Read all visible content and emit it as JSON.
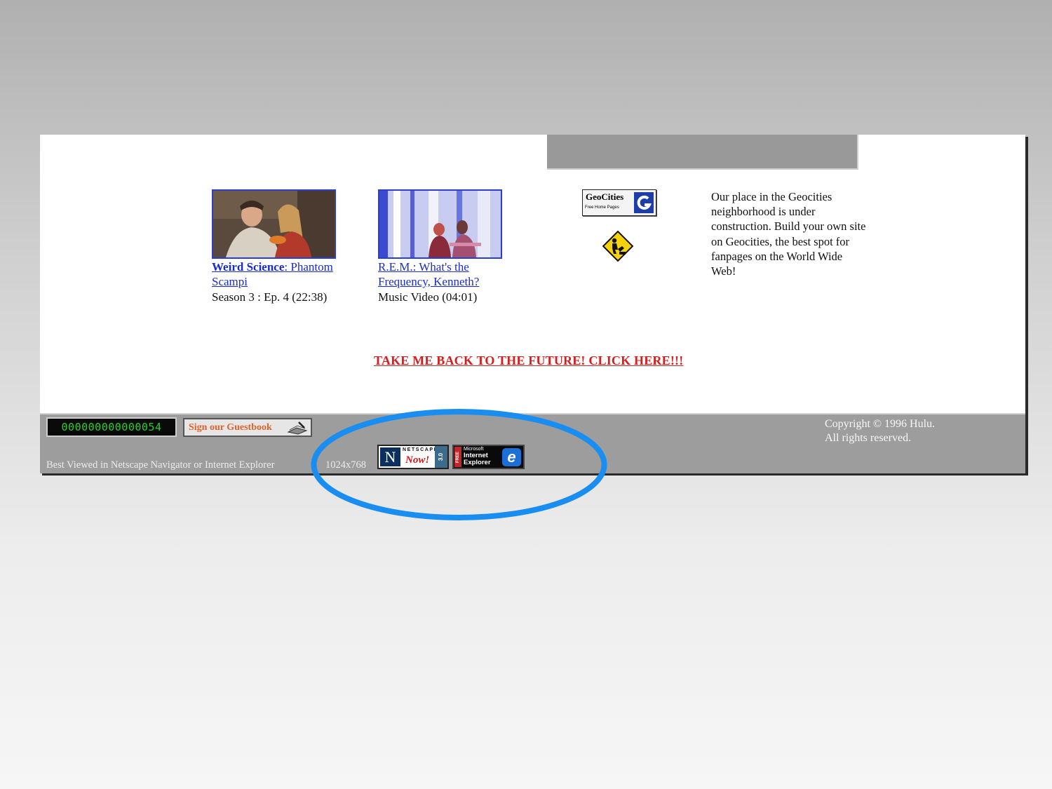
{
  "videos": [
    {
      "show": "Weird Science",
      "episode": ": Phantom Scampi",
      "meta": "Season 3 : Ep. 4 (22:38)"
    },
    {
      "show": "R.E.M.",
      "episode": ": What's the Frequency, Kenneth?",
      "meta": "Music Video (04:01)"
    }
  ],
  "geocities": {
    "badge_title": "GeoCities",
    "badge_sub": "Free Home Pages",
    "text": "Our place in the Geocities neighborhood is under construction. Build your own site on Geocities, the best spot for fanpages on the World Wide Web!"
  },
  "back_link": "TAKE ME BACK TO THE FUTURE! CLICK HERE!!!",
  "footer": {
    "counter": "000000000000054",
    "guestbook": "Sign our Guestbook",
    "best_viewed": "Best Viewed in Netscape Navigator or Internet Explorer",
    "resolution": "1024x768",
    "netscape": {
      "word": "NETSCAPE",
      "tagline": "Now!",
      "version": "3.0"
    },
    "ie": {
      "free": "FREE",
      "maker": "Microsoft",
      "line1": "Internet",
      "line2": "Explorer"
    },
    "copyright_line1": "Copyright © 1996 Hulu.",
    "copyright_line2": "All rights reserved."
  },
  "colors": {
    "link_blue": "#1a2bd1",
    "link_red": "#d61e1e",
    "footer_gray": "#9d9d9d",
    "highlight_circle": "#1a8ef0",
    "counter_green": "#26d226"
  },
  "icons": [
    "video-thumbnail-weird-science",
    "video-thumbnail-rem",
    "geocities-icon",
    "under-construction-icon",
    "guestbook-icon",
    "netscape-icon",
    "internet-explorer-icon"
  ]
}
